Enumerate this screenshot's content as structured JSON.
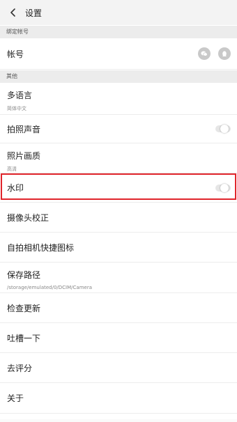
{
  "header": {
    "title": "设置"
  },
  "sections": {
    "bind": "绑定帐号",
    "other": "其他"
  },
  "rows": {
    "account": {
      "label": "帐号"
    },
    "language": {
      "label": "多语言",
      "value": "简体中文"
    },
    "shutter_sound": {
      "label": "拍照声音",
      "on": false
    },
    "photo_quality": {
      "label": "照片画质",
      "value": "高清"
    },
    "watermark": {
      "label": "水印",
      "on": false
    },
    "camera_correction": {
      "label": "摄像头校正"
    },
    "selfie_shortcut": {
      "label": "自拍相机快捷图标"
    },
    "save_path": {
      "label": "保存路径",
      "value": "/storage/emulated/0/DCIM/Camera"
    },
    "check_update": {
      "label": "检查更新"
    },
    "feedback": {
      "label": "吐槽一下"
    },
    "rate": {
      "label": "去评分"
    },
    "about": {
      "label": "关于"
    }
  },
  "colors": {
    "highlight": "#e0242b",
    "toggle_off": "#e6e6e6"
  },
  "icons": {
    "back": "chevron-left-icon",
    "wechat": "wechat-icon",
    "qq": "qq-icon"
  }
}
